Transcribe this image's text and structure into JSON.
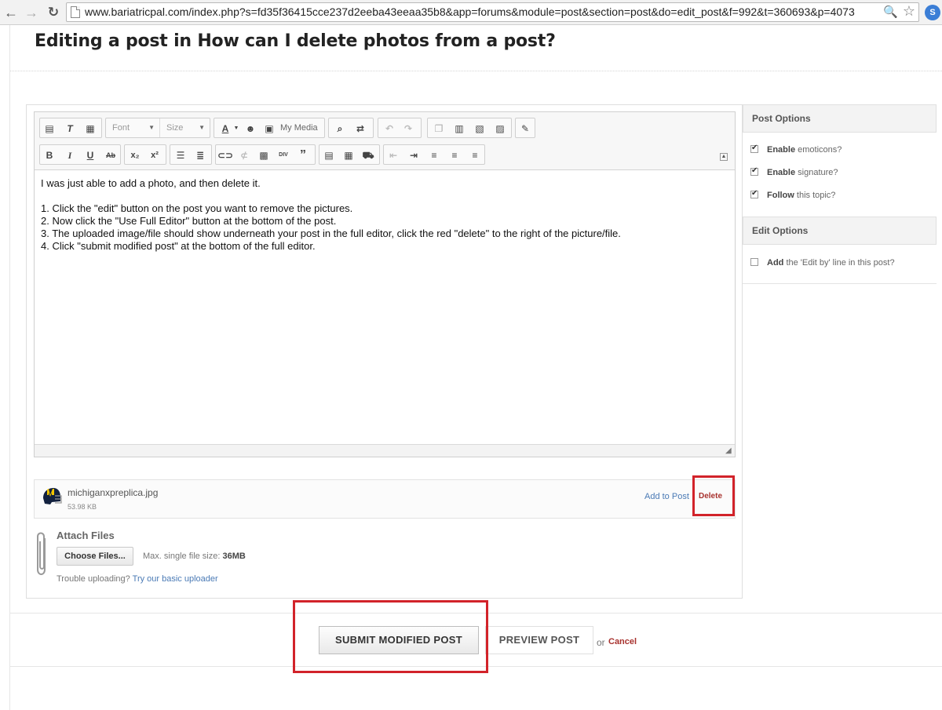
{
  "browser": {
    "url": "www.bariatricpal.com/index.php?s=fd35f36415cce237d2eeba43eeaa35b8&app=forums&module=post&section=post&do=edit_post&f=992&t=360693&p=4073",
    "extension_label": "S"
  },
  "page": {
    "title": "Editing a post in How can I delete photos from a post?"
  },
  "editor": {
    "font_select": "Font",
    "size_select": "Size",
    "my_media": "My Media",
    "lines": [
      "I was just able to add a photo, and then delete it.",
      "",
      "1.  Click the \"edit\" button on the post you want to remove the pictures.",
      "2.  Now click the \"Use Full Editor\" button at the bottom of the post.",
      "3.  The uploaded image/file should show underneath your post in the full editor, click the red \"delete\" to the right of the picture/file.",
      "4.  Click \"submit modified post\" at the bottom of the full editor."
    ]
  },
  "attachment": {
    "file_name": "michiganxpreplica.jpg",
    "file_size": "53.98 KB",
    "add_to_post": "Add to Post",
    "delete": "Delete"
  },
  "attach_files": {
    "title": "Attach Files",
    "choose_button": "Choose Files...",
    "max_size_label": "Max. single file size:",
    "max_size_value": "36MB",
    "trouble_text": "Trouble uploading?",
    "basic_uploader": "Try our basic uploader"
  },
  "sidebar": {
    "post_options_title": "Post Options",
    "post_options": [
      {
        "bold": "Enable",
        "rest": "emoticons?",
        "checked": true
      },
      {
        "bold": "Enable",
        "rest": "signature?",
        "checked": true
      },
      {
        "bold": "Follow",
        "rest": "this topic?",
        "checked": true
      }
    ],
    "edit_options_title": "Edit Options",
    "edit_option": {
      "bold": "Add",
      "rest": "the 'Edit by' line in this post?",
      "checked": false
    }
  },
  "actions": {
    "submit": "SUBMIT MODIFIED POST",
    "preview": "PREVIEW POST",
    "or": "or",
    "cancel": "Cancel"
  },
  "colors": {
    "highlight": "#d2232a",
    "link": "#4a7ab5",
    "danger_link": "#a8322e"
  }
}
